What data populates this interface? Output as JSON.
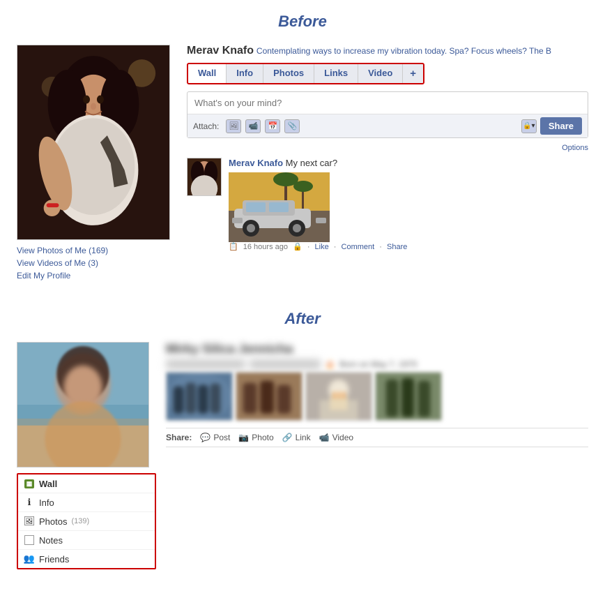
{
  "before": {
    "title": "Before",
    "profile": {
      "name": "Merav Knafo",
      "status": "Contemplating ways to increase my vibration today. Spa? Focus wheels? The B",
      "links": [
        {
          "id": "view-photos",
          "text": "View Photos of Me (169)"
        },
        {
          "id": "view-videos",
          "text": "View Videos of Me (3)"
        },
        {
          "id": "edit-profile",
          "text": "Edit My Profile"
        }
      ]
    },
    "tabs": [
      {
        "id": "wall",
        "label": "Wall",
        "active": true
      },
      {
        "id": "info",
        "label": "Info",
        "active": false
      },
      {
        "id": "photos",
        "label": "Photos",
        "active": false
      },
      {
        "id": "links",
        "label": "Links",
        "active": false
      },
      {
        "id": "video",
        "label": "Video",
        "active": false
      },
      {
        "id": "plus",
        "label": "+",
        "active": false
      }
    ],
    "post_box": {
      "placeholder": "What's on your mind?",
      "attach_label": "Attach:",
      "share_label": "Share",
      "options_label": "Options"
    },
    "post": {
      "author": "Merav Knafo",
      "text": "My next car?",
      "time": "16 hours ago",
      "actions": [
        "Like",
        "Comment",
        "Share"
      ]
    }
  },
  "after": {
    "title": "After",
    "profile": {
      "name": "Mirky Silica Jennicha",
      "status_blurred": "In a Relationship with",
      "born": "Born on May 7, 1970"
    },
    "sidebar_nav": [
      {
        "id": "wall",
        "label": "Wall",
        "icon": "wall",
        "active": true
      },
      {
        "id": "info",
        "label": "Info",
        "icon": "info",
        "active": false
      },
      {
        "id": "photos",
        "label": "Photos",
        "icon": "photos",
        "count": "(139)",
        "active": false
      },
      {
        "id": "notes",
        "label": "Notes",
        "icon": "notes",
        "active": false
      },
      {
        "id": "friends",
        "label": "Friends",
        "icon": "friends",
        "active": false
      }
    ],
    "share_bar": {
      "label": "Share:",
      "items": [
        {
          "id": "post",
          "label": "Post",
          "icon": "post-icon"
        },
        {
          "id": "photo",
          "label": "Photo",
          "icon": "photo-icon"
        },
        {
          "id": "link",
          "label": "Link",
          "icon": "link-icon"
        },
        {
          "id": "video",
          "label": "Video",
          "icon": "video-icon"
        }
      ]
    }
  }
}
